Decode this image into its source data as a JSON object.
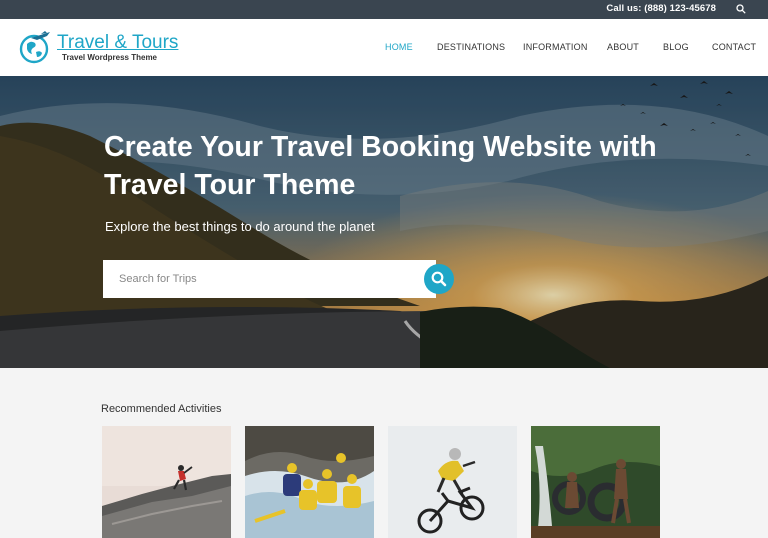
{
  "topbar": {
    "call_text": "Call us: (888) 123-45678",
    "search_icon": "search-icon"
  },
  "logo": {
    "title": "Travel & Tours",
    "subtitle": "Travel Wordpress Theme",
    "icon": "globe-plane-icon"
  },
  "nav": {
    "items": [
      {
        "label": "HOME",
        "active": true
      },
      {
        "label": "DESTINATIONS",
        "active": false
      },
      {
        "label": "INFORMATION",
        "active": false
      },
      {
        "label": "ABOUT",
        "active": false
      },
      {
        "label": "BLOG",
        "active": false
      },
      {
        "label": "CONTACT",
        "active": false
      }
    ]
  },
  "hero": {
    "title": "Create Your Travel Booking Website with Travel Tour Theme",
    "subtitle": "Explore the best things to do around the planet",
    "search_placeholder": "Search for Trips",
    "search_icon": "search-icon"
  },
  "activities": {
    "title": "Recommended Activities",
    "cards": [
      {
        "image": "rock-climbing-photo"
      },
      {
        "image": "rafting-photo"
      },
      {
        "image": "mountain-biking-photo"
      },
      {
        "image": "waterfall-tubing-photo"
      }
    ]
  },
  "colors": {
    "accent": "#1fa6c7",
    "topbar": "#3a4550",
    "text": "#333333",
    "page_bg": "#f4f4f4"
  }
}
